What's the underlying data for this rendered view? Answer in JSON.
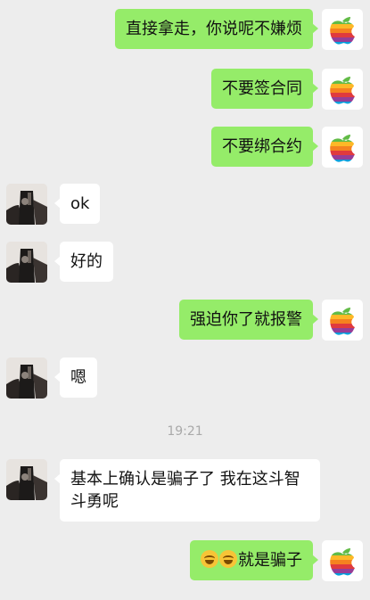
{
  "colors": {
    "background": "#ededed",
    "outgoing_bubble": "#95ec69",
    "incoming_bubble": "#ffffff",
    "timestamp_text": "#a9a9a9"
  },
  "messages": [
    {
      "direction": "out",
      "text": "直接拿走，你说呢不嫌烦",
      "avatar_icon": "rainbow-apple-logo-icon"
    },
    {
      "direction": "out",
      "text": "不要签合同",
      "avatar_icon": "rainbow-apple-logo-icon"
    },
    {
      "direction": "out",
      "text": "不要绑合约",
      "avatar_icon": "rainbow-apple-logo-icon"
    },
    {
      "direction": "in",
      "text": "ok",
      "avatar_icon": "contact-photo-avatar"
    },
    {
      "direction": "in",
      "text": "好的",
      "avatar_icon": "contact-photo-avatar"
    },
    {
      "direction": "out",
      "text": "强迫你了就报警",
      "avatar_icon": "rainbow-apple-logo-icon"
    },
    {
      "direction": "in",
      "text": "嗯",
      "avatar_icon": "contact-photo-avatar"
    },
    {
      "direction": "in",
      "text": "基本上确认是骗子了 我在这斗智斗勇呢",
      "avatar_icon": "contact-photo-avatar"
    },
    {
      "direction": "out",
      "text": "就是骗子",
      "emoji_prefix": [
        "face-with-tears-of-joy-emoji",
        "rolling-on-floor-laughing-emoji"
      ],
      "avatar_icon": "rainbow-apple-logo-icon"
    }
  ],
  "timestamp": "19:21"
}
